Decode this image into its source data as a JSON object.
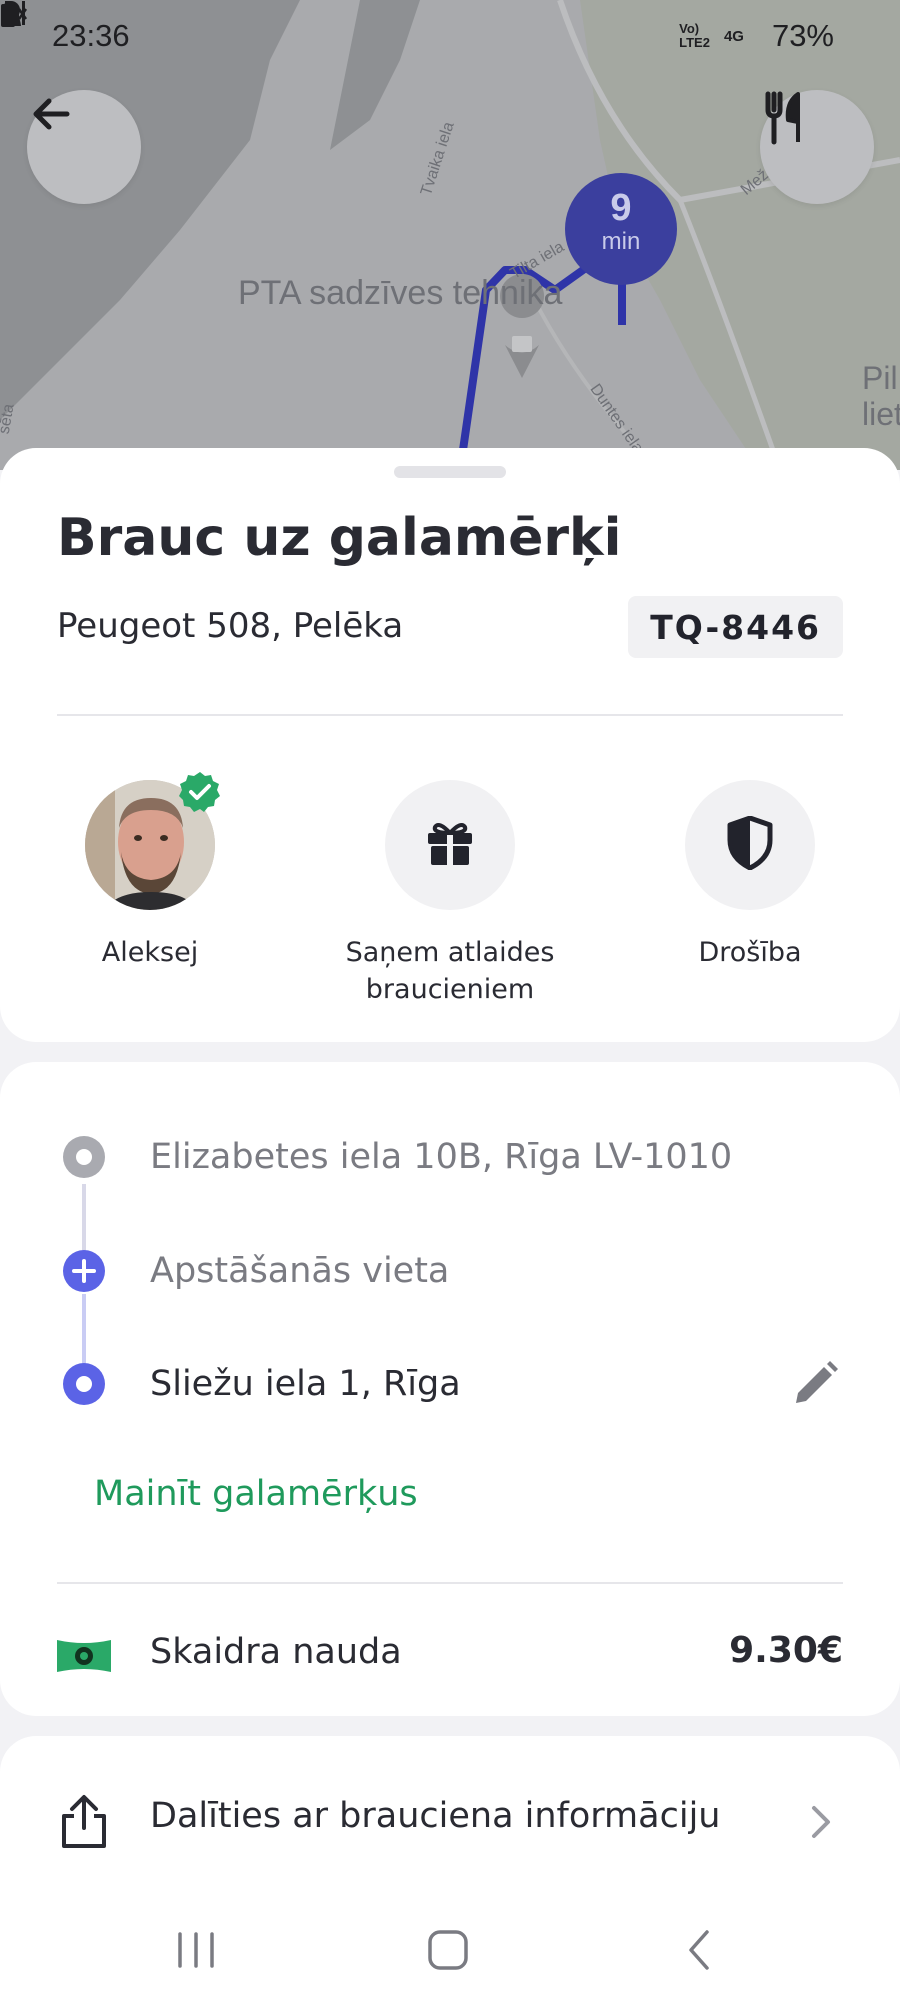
{
  "status_bar": {
    "time": "23:36",
    "battery": "73%",
    "network_label_top": "Vo)",
    "network_label_bottom": "LTE2",
    "network_type": "4G",
    "icons": [
      "person-icon",
      "mute-icon",
      "location-icon",
      "signal-icon",
      "battery-icon"
    ]
  },
  "map": {
    "labels": {
      "place": "PTA sadzīves tehnika",
      "street_1": "Tvaika iela",
      "street_2": "Tilta iela",
      "street_3": "Duntes iela",
      "street_4": "Mež",
      "edge_right": "Pil",
      "edge_right_2": "liet",
      "edge_left": "sēta"
    },
    "eta": {
      "value": "9",
      "unit": "min"
    },
    "route_color": "#2f34a8"
  },
  "trip": {
    "title": "Brauc uz galamērķi",
    "vehicle": "Peugeot 508, Pelēka",
    "plate": "TQ-8446",
    "actions": {
      "driver_name": "Aleksej",
      "discounts": "Saņem atlaides braucieniem",
      "safety": "Drošība"
    }
  },
  "route": {
    "pickup": "Elizabetes iela 10B, Rīga LV-1010",
    "add_stop": "Apstāšanās vieta",
    "destination": "Sliežu iela 1, Rīga",
    "change_destination": "Mainīt galamērķus"
  },
  "payment": {
    "method": "Skaidra nauda",
    "amount": "9.30€"
  },
  "share": {
    "label": "Dalīties ar brauciena informāciju"
  },
  "colors": {
    "accent_green": "#1f9a5c",
    "route_blue": "#5b63e6",
    "text_dark": "#2a2b33",
    "text_muted": "#7a7b82"
  }
}
